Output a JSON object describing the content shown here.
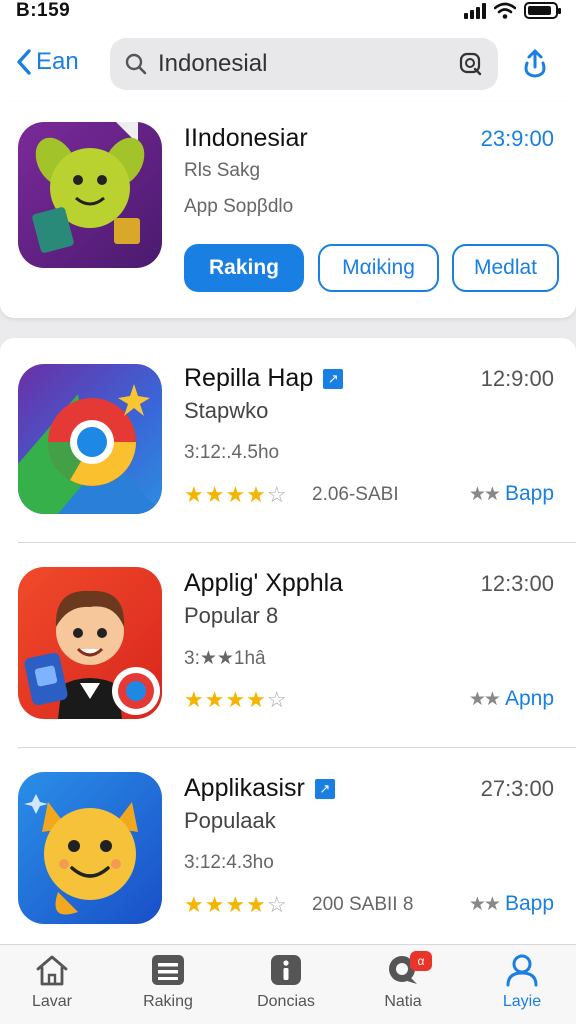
{
  "status_bar": {
    "time": "B:159",
    "battery_level": 0.9
  },
  "header": {
    "back_label": "Ean",
    "search": {
      "value": "Indonesial"
    }
  },
  "featured": {
    "title": "IIndonesiar",
    "time": "23:9:00",
    "subtitle": "Rls Sakg",
    "subtitle2": "Apр Sopβdlo",
    "buttons": [
      "Raking",
      "Mαiking",
      "Medlat"
    ]
  },
  "apps": [
    {
      "title": "Repilla Hap",
      "time": "12:9:00",
      "subtitle": "Stapwko",
      "meta": "3:12:.4.5ho",
      "rating": 4,
      "count": "2.06-SABI",
      "action": "Bapp"
    },
    {
      "title": "Applig' Xpphla",
      "time": "12:3:00",
      "subtitle": "Popular 8",
      "meta": "3:★★1hâ",
      "rating": 4,
      "count": "",
      "action": "Apnp"
    },
    {
      "title": "Applikasisr",
      "time": "27:3:00",
      "subtitle": "Populaak",
      "meta": "3:12:4.3ho",
      "rating": 4,
      "count": "200 SABII 8",
      "action": "Bapp"
    }
  ],
  "tabs": [
    {
      "label": "Lavar",
      "icon": "home-icon"
    },
    {
      "label": "Raking",
      "icon": "list-icon"
    },
    {
      "label": "Doncias",
      "icon": "info-icon"
    },
    {
      "label": "Natia",
      "icon": "chat-icon",
      "badge": "α"
    },
    {
      "label": "Layie",
      "icon": "person-icon",
      "active": true
    }
  ],
  "colors": {
    "accent": "#1a7fe3",
    "star": "#f5b400",
    "badge": "#e9342a"
  }
}
